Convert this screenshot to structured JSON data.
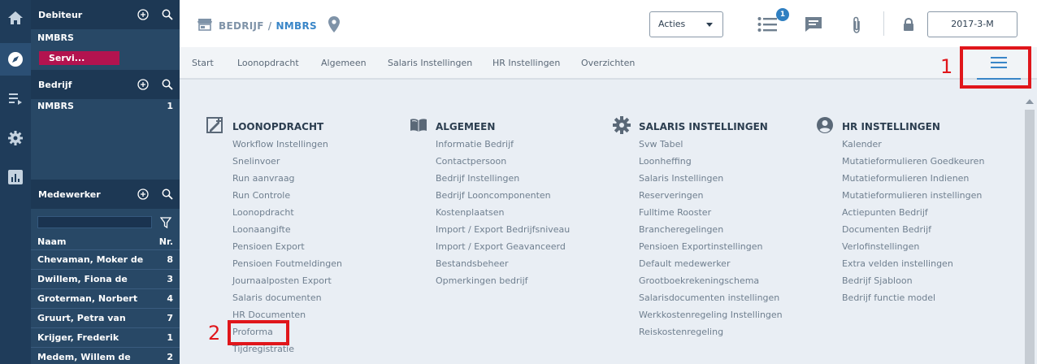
{
  "rail": {
    "icons": [
      "home-icon",
      "compass-icon",
      "list-icon",
      "gear-icon",
      "chart-icon"
    ]
  },
  "nav": {
    "debiteur": {
      "title": "Debiteur",
      "name": "NMBRS",
      "badge": "Servi..."
    },
    "bedrijf": {
      "title": "Bedrijf",
      "name": "NMBRS",
      "count": "1"
    },
    "medewerker": {
      "title": "Medewerker",
      "col_name": "Naam",
      "col_nr": "Nr.",
      "rows": [
        {
          "name": "Chevaman, Moker de",
          "nr": "8"
        },
        {
          "name": "Dwillem, Fiona de",
          "nr": "3"
        },
        {
          "name": "Groterman, Norbert",
          "nr": "4"
        },
        {
          "name": "Gruurt, Petra van",
          "nr": "7"
        },
        {
          "name": "Krijger, Frederik",
          "nr": "1"
        },
        {
          "name": "Medem, Willem de",
          "nr": "2"
        }
      ]
    }
  },
  "header": {
    "company_label": "BEDRIJF",
    "separator": "/",
    "company_name": "NMBRS",
    "actions_label": "Acties",
    "task_badge": "1",
    "period": "2017-3-M"
  },
  "tabs": [
    "Start",
    "Loonopdracht",
    "Algemeen",
    "Salaris Instellingen",
    "HR Instellingen",
    "Overzichten"
  ],
  "annotations": {
    "one": "1",
    "two": "2"
  },
  "menu": {
    "loonopdracht": {
      "title": "LOONOPDRACHT",
      "items": [
        "Workflow Instellingen",
        "Snelinvoer",
        "Run aanvraag",
        "Run Controle",
        "Loonopdracht",
        "Loonaangifte",
        "Pensioen Export",
        "Pensioen Foutmeldingen",
        "Journaalposten Export",
        "Salaris documenten",
        "HR Documenten",
        "Proforma",
        "Tijdregistratie"
      ]
    },
    "algemeen": {
      "title": "ALGEMEEN",
      "items": [
        "Informatie Bedrijf",
        "Contactpersoon",
        "Bedrijf Instellingen",
        "Bedrijf Looncomponenten",
        "Kostenplaatsen",
        "Import / Export Bedrijfsniveau",
        "Import / Export Geavanceerd",
        "Bestandsbeheer",
        "Opmerkingen bedrijf"
      ]
    },
    "salaris": {
      "title": "SALARIS INSTELLINGEN",
      "items": [
        "Svw Tabel",
        "Loonheffing",
        "Salaris Instellingen",
        "Reserveringen",
        "Fulltime Rooster",
        "Brancheregelingen",
        "Pensioen Exportinstellingen",
        "Default medewerker",
        "Grootboekrekeningschema",
        "Salarisdocumenten instellingen",
        "Werkkostenregeling Instellingen",
        "Reiskostenregeling"
      ]
    },
    "hr": {
      "title": "HR INSTELLINGEN",
      "items": [
        "Kalender",
        "Mutatieformulieren Goedkeuren",
        "Mutatieformulieren Indienen",
        "Mutatieformulieren instellingen",
        "Actiepunten Bedrijf",
        "Documenten Bedrijf",
        "Verlofinstellingen",
        "Extra velden instellingen",
        "Bedrijf Sjabloon",
        "Bedrijf functie model"
      ]
    }
  }
}
